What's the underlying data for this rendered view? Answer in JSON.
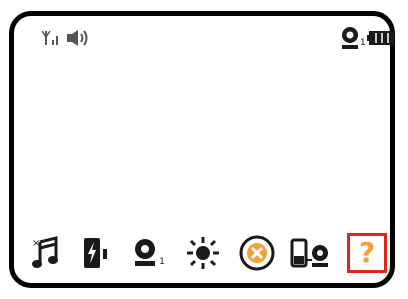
{
  "status_bar": {
    "signal_icon": "signal-antenna-icon",
    "volume_icon": "speaker-volume-icon",
    "camera_icon": "webcam-icon",
    "camera_index": "1",
    "battery_icon": "battery-icon"
  },
  "icon_bar": {
    "items": [
      {
        "name": "music-note-icon",
        "label": ""
      },
      {
        "name": "battery-charging-icon",
        "label": ""
      },
      {
        "name": "webcam-icon",
        "label": "1"
      },
      {
        "name": "brightness-sun-icon",
        "label": ""
      },
      {
        "name": "cancel-circle-icon",
        "label": ""
      },
      {
        "name": "phone-webcam-link-icon",
        "label": ""
      },
      {
        "name": "help-icon",
        "label": "?"
      }
    ],
    "selected_index": 6
  },
  "colors": {
    "border": "#000000",
    "highlight_border": "#e0251b",
    "accent_orange": "#f5a031",
    "icon_dark": "#1a1a1a"
  }
}
